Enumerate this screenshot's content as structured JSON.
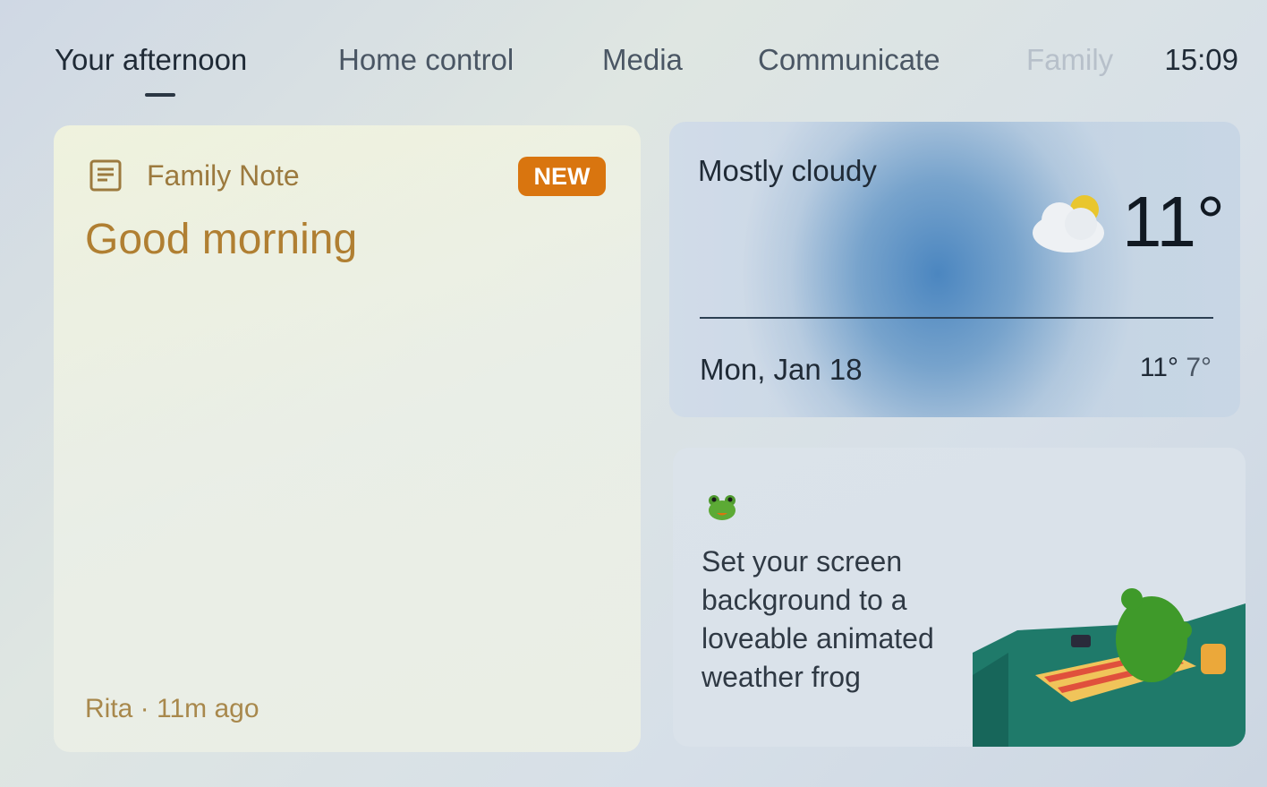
{
  "nav": {
    "tabs": [
      {
        "label": "Your afternoon",
        "state": "active"
      },
      {
        "label": "Home control",
        "state": "normal"
      },
      {
        "label": "Media",
        "state": "normal"
      },
      {
        "label": "Communicate",
        "state": "normal"
      },
      {
        "label": "Family",
        "state": "faded"
      }
    ],
    "clock": "15:09"
  },
  "note_card": {
    "icon": "note-icon",
    "type_label": "Family Note",
    "badge": "NEW",
    "title": "Good morning",
    "meta": "Rita · 11m ago",
    "accent_color": "#d9750f"
  },
  "weather_card": {
    "condition": "Mostly cloudy",
    "icon": "partly-cloudy-icon",
    "temperature": "11°",
    "date": "Mon, Jan 18",
    "high": "11°",
    "low": "7°"
  },
  "promo_card": {
    "icon": "frog-icon",
    "text": "Set your screen background to a loveable animated weather frog",
    "illustration": "frog-on-picnic-blanket-illustration"
  }
}
